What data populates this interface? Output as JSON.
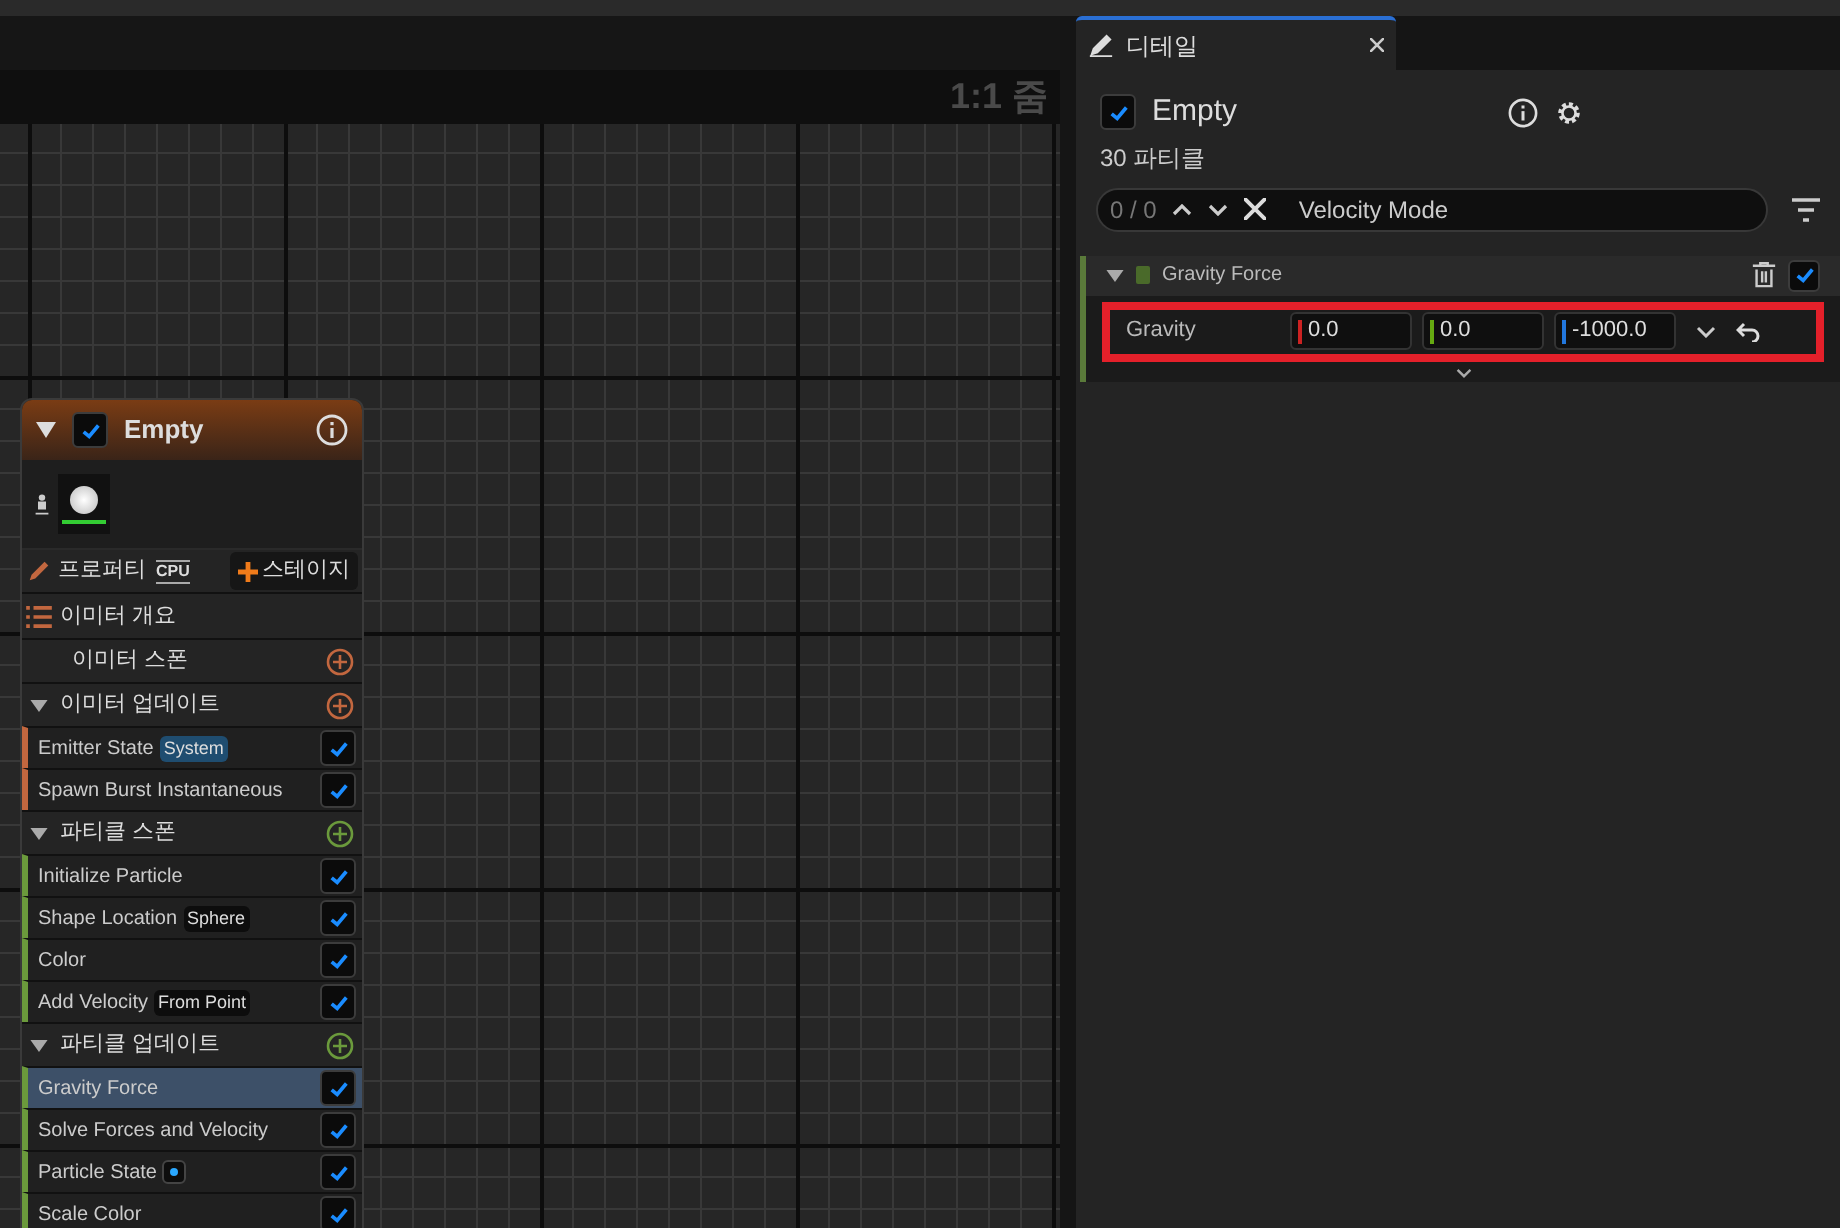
{
  "canvas": {
    "zoom_label": "1:1 줌"
  },
  "node": {
    "title": "Empty",
    "enabled": true,
    "properties_label": "프로퍼티",
    "sim_target": "CPU",
    "add_stage": "스테이지",
    "overview": "이미터 개요",
    "stages": [
      {
        "label": "이미터 스폰",
        "expanded": false,
        "color": "#c2673f"
      },
      {
        "label": "이미터 업데이트",
        "expanded": true,
        "color": "#c2673f",
        "modules": [
          {
            "label": "Emitter State",
            "enabled": true,
            "selected": false,
            "tag": {
              "kind": "highlight",
              "text": "System"
            }
          },
          {
            "label": "Spawn Burst Instantaneous",
            "enabled": true,
            "selected": false
          }
        ]
      },
      {
        "label": "파티클 스폰",
        "expanded": true,
        "color": "#6b9a3c",
        "modules": [
          {
            "label": "Initialize Particle",
            "enabled": true,
            "selected": false
          },
          {
            "label": "Shape Location",
            "enabled": true,
            "selected": false,
            "tag": {
              "kind": "plain",
              "text": "Sphere"
            }
          },
          {
            "label": "Color",
            "enabled": true,
            "selected": false
          },
          {
            "label": "Add Velocity",
            "enabled": true,
            "selected": false,
            "tag": {
              "kind": "plain",
              "text": "From Point"
            }
          }
        ]
      },
      {
        "label": "파티클 업데이트",
        "expanded": true,
        "color": "#6b9a3c",
        "modules": [
          {
            "label": "Gravity Force",
            "enabled": true,
            "selected": true
          },
          {
            "label": "Solve Forces and Velocity",
            "enabled": true,
            "selected": false
          },
          {
            "label": "Particle State",
            "enabled": true,
            "selected": false,
            "tag": {
              "kind": "dot"
            }
          },
          {
            "label": "Scale Color",
            "enabled": true,
            "selected": false
          }
        ]
      }
    ]
  },
  "details": {
    "tab": "디테일",
    "title": "Empty",
    "enabled": true,
    "count": "30 파티클",
    "search": {
      "counter": "0 / 0",
      "value": "Velocity Mode"
    },
    "module": {
      "title": "Gravity Force",
      "enabled": true,
      "expanded": true,
      "properties": [
        {
          "label": "Gravity",
          "values": [
            "0.0",
            "0.0",
            "-1000.0"
          ],
          "highlighted": true
        }
      ]
    }
  }
}
